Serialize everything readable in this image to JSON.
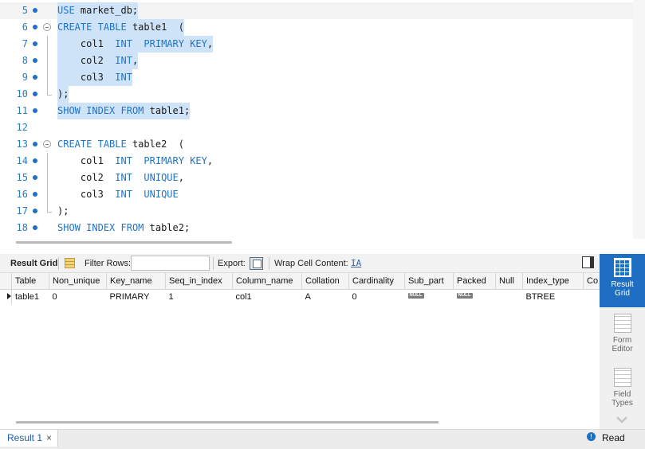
{
  "editor": {
    "lines": [
      {
        "num": "5",
        "tokens": [
          {
            "t": "USE",
            "k": true
          },
          {
            "t": " market_db;",
            "k": false
          }
        ]
      },
      {
        "num": "6",
        "tokens": [
          {
            "t": "CREATE",
            "k": true
          },
          {
            "t": " ",
            "k": false
          },
          {
            "t": "TABLE",
            "k": true
          },
          {
            "t": " table1  (",
            "k": false
          }
        ]
      },
      {
        "num": "7",
        "tokens": [
          {
            "t": "    col1  ",
            "k": false
          },
          {
            "t": "INT",
            "k": true
          },
          {
            "t": "  ",
            "k": false
          },
          {
            "t": "PRIMARY KEY",
            "k": true
          },
          {
            "t": ",",
            "k": false
          }
        ]
      },
      {
        "num": "8",
        "tokens": [
          {
            "t": "    col2  ",
            "k": false
          },
          {
            "t": "INT",
            "k": true
          },
          {
            "t": ",",
            "k": false
          }
        ]
      },
      {
        "num": "9",
        "tokens": [
          {
            "t": "    col3  ",
            "k": false
          },
          {
            "t": "INT",
            "k": true
          }
        ]
      },
      {
        "num": "10",
        "tokens": [
          {
            "t": ");",
            "k": false
          }
        ]
      },
      {
        "num": "11",
        "tokens": [
          {
            "t": "SHOW",
            "k": true
          },
          {
            "t": " ",
            "k": false
          },
          {
            "t": "INDEX",
            "k": true
          },
          {
            "t": " ",
            "k": false
          },
          {
            "t": "FROM",
            "k": true
          },
          {
            "t": " table1;",
            "k": false
          }
        ]
      },
      {
        "num": "12",
        "tokens": []
      },
      {
        "num": "13",
        "tokens": [
          {
            "t": "CREATE",
            "k": true
          },
          {
            "t": " ",
            "k": false
          },
          {
            "t": "TABLE",
            "k": true
          },
          {
            "t": " table2  (",
            "k": false
          }
        ]
      },
      {
        "num": "14",
        "tokens": [
          {
            "t": "    col1  ",
            "k": false
          },
          {
            "t": "INT",
            "k": true
          },
          {
            "t": "  ",
            "k": false
          },
          {
            "t": "PRIMARY KEY",
            "k": true
          },
          {
            "t": ",",
            "k": false
          }
        ]
      },
      {
        "num": "15",
        "tokens": [
          {
            "t": "    col2  ",
            "k": false
          },
          {
            "t": "INT",
            "k": true
          },
          {
            "t": "  ",
            "k": false
          },
          {
            "t": "UNIQUE",
            "k": true
          },
          {
            "t": ",",
            "k": false
          }
        ]
      },
      {
        "num": "16",
        "tokens": [
          {
            "t": "    col3  ",
            "k": false
          },
          {
            "t": "INT",
            "k": true
          },
          {
            "t": "  ",
            "k": false
          },
          {
            "t": "UNIQUE",
            "k": true
          }
        ]
      },
      {
        "num": "17",
        "tokens": [
          {
            "t": ");",
            "k": false
          }
        ]
      },
      {
        "num": "18",
        "tokens": [
          {
            "t": "SHOW",
            "k": true
          },
          {
            "t": " ",
            "k": false
          },
          {
            "t": "INDEX",
            "k": true
          },
          {
            "t": " ",
            "k": false
          },
          {
            "t": "FROM",
            "k": true
          },
          {
            "t": " table2;",
            "k": false
          }
        ]
      }
    ]
  },
  "toolbar": {
    "result_grid": "Result Grid",
    "filter_rows": "Filter Rows:",
    "export": "Export:",
    "wrap_cell": "Wrap Cell Content:",
    "wrap_icon": "IA"
  },
  "grid": {
    "columns": [
      "Table",
      "Non_unique",
      "Key_name",
      "Seq_in_index",
      "Column_name",
      "Collation",
      "Cardinality",
      "Sub_part",
      "Packed",
      "Null",
      "Index_type",
      "Co"
    ],
    "rows": [
      [
        "table1",
        "0",
        "PRIMARY",
        "1",
        "col1",
        "A",
        "0",
        "NULL",
        "NULL",
        "",
        "BTREE",
        ""
      ]
    ],
    "null_label": "NULL"
  },
  "side_panel": {
    "result_grid": "Result Grid",
    "form_editor": "Form Editor",
    "field_types": "Field Types"
  },
  "bottom": {
    "tab_label": "Result 1",
    "close": "×",
    "read_only": "Read Only",
    "info_glyph": "!"
  }
}
